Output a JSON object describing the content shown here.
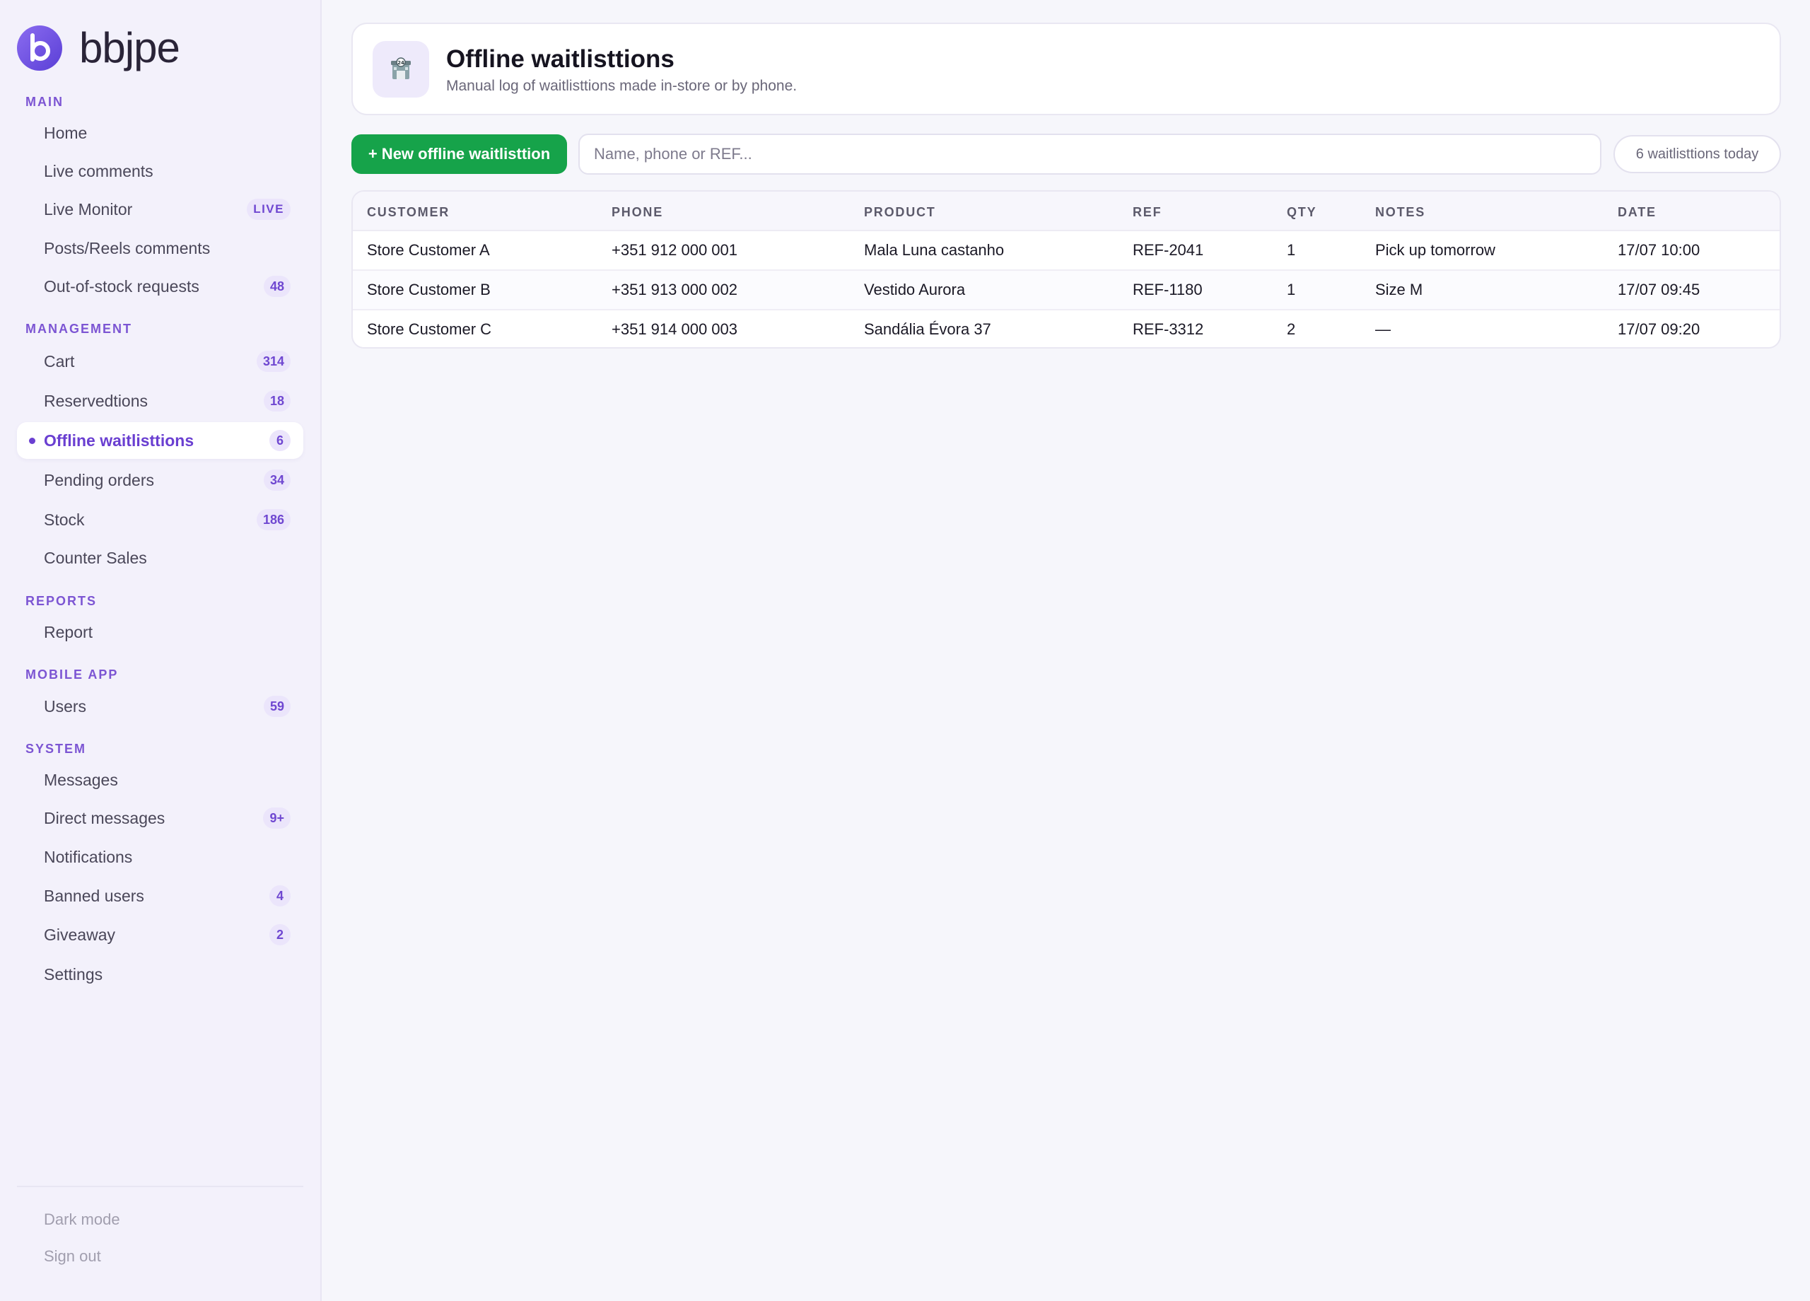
{
  "brand": {
    "name": "bbjpe",
    "color": "#6e4ee6"
  },
  "sidebar": {
    "sections": [
      {
        "label": "MAIN",
        "items": [
          {
            "label": "Home"
          },
          {
            "label": "Live comments"
          },
          {
            "label": "Live Monitor",
            "badge": "LIVE"
          },
          {
            "label": "Posts/Reels comments"
          },
          {
            "label": "Out-of-stock requests",
            "badge": "48"
          }
        ]
      },
      {
        "label": "MANAGEMENT",
        "items": [
          {
            "label": "Cart",
            "badge": "314"
          },
          {
            "label": "Reservedtions",
            "badge": "18"
          },
          {
            "label": "Offline waitlisttions",
            "badge": "6",
            "active": true
          },
          {
            "label": "Pending orders",
            "badge": "34"
          },
          {
            "label": "Stock",
            "badge": "186"
          },
          {
            "label": "Counter Sales"
          }
        ]
      },
      {
        "label": "REPORTS",
        "items": [
          {
            "label": "Report"
          }
        ]
      },
      {
        "label": "MOBILE APP",
        "items": [
          {
            "label": "Users",
            "badge": "59"
          }
        ]
      },
      {
        "label": "SYSTEM",
        "items": [
          {
            "label": "Messages"
          },
          {
            "label": "Direct messages",
            "badge": "9+"
          },
          {
            "label": "Notifications"
          },
          {
            "label": "Banned users",
            "badge": "4"
          },
          {
            "label": "Giveaway",
            "badge": "2"
          },
          {
            "label": "Settings"
          }
        ]
      }
    ],
    "footer": {
      "dark_mode": "Dark mode",
      "sign_out": "Sign out"
    }
  },
  "header": {
    "icon": "store-icon",
    "title": "Offline waitlisttions",
    "subtitle": "Manual log of waitlisttions made in-store or by phone."
  },
  "toolbar": {
    "new_button": "+ New offline waitlisttion",
    "new_button_color": "#16a34a",
    "search_placeholder": "Name, phone or REF...",
    "search_value": "",
    "count_label": "6 waitlisttions today"
  },
  "table": {
    "columns": [
      "CUSTOMER",
      "PHONE",
      "PRODUCT",
      "REF",
      "QTY",
      "NOTES",
      "DATE"
    ],
    "rows": [
      [
        "Store Customer A",
        "+351 912 000 001",
        "Mala Luna castanho",
        "REF-2041",
        "1",
        "Pick up tomorrow",
        "17/07 10:00"
      ],
      [
        "Store Customer B",
        "+351 913 000 002",
        "Vestido Aurora",
        "REF-1180",
        "1",
        "Size M",
        "17/07 09:45"
      ],
      [
        "Store Customer C",
        "+351 914 000 003",
        "Sandália Évora 37",
        "REF-3312",
        "2",
        "—",
        "17/07 09:20"
      ]
    ]
  },
  "accent": "#6a3fd1"
}
